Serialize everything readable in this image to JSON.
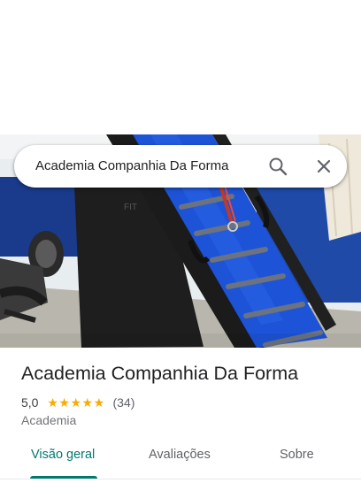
{
  "search": {
    "query": "Academia Companhia Da Forma",
    "search_icon": "search-icon",
    "close_icon": "close-icon"
  },
  "place": {
    "name": "Academia Companhia Da Forma",
    "rating": "5,0",
    "stars": "★★★★★",
    "star_count": 5,
    "review_count": "(34)",
    "category": "Academia"
  },
  "tabs": [
    {
      "label": "Visão geral",
      "active": true
    },
    {
      "label": "Avaliações",
      "active": false
    },
    {
      "label": "Sobre",
      "active": false
    }
  ],
  "colors": {
    "accent": "#01796f",
    "star": "#f9ab00"
  }
}
